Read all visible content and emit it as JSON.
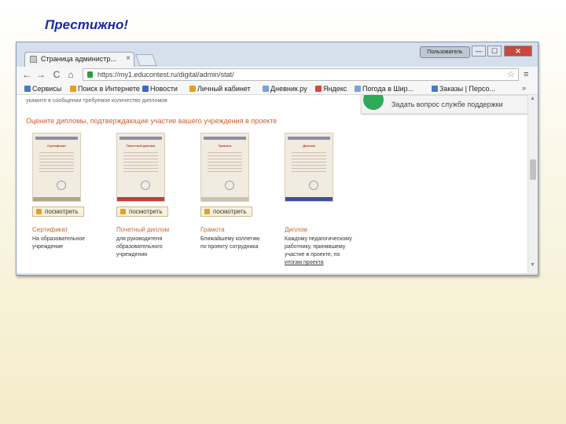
{
  "slide": {
    "title": "Престижно!"
  },
  "window": {
    "tab_title": "Страница администр...",
    "tab_close": "×",
    "profile_label": "Пользователь",
    "minimize": "—",
    "maximize": "☐",
    "close": "✕"
  },
  "toolbar": {
    "back": "←",
    "forward": "→",
    "reload": "C",
    "home": "⌂",
    "url": "https://my1.educontest.ru/digital/admin/stat/",
    "star": "☆",
    "menu": "≡"
  },
  "bookmarks": {
    "items": [
      {
        "label": "Сервисы",
        "color": "#4a78c8"
      },
      {
        "label": "Поиск в Интернете",
        "color": "#e2a125"
      },
      {
        "label": "Новости",
        "color": "#3d6bc1"
      },
      {
        "label": "Личный кабинет",
        "color": "#e2a125"
      },
      {
        "label": "Дневник.ру",
        "color": "#7aa3d8"
      },
      {
        "label": "Яндекс",
        "color": "#d9473d"
      },
      {
        "label": "Погода в Шир...",
        "color": "#7aa3d8"
      },
      {
        "label": "Заказы | Персо...",
        "color": "#4a78c8"
      }
    ],
    "more": "»"
  },
  "page": {
    "notice": "укажите в сообщении требуемое количество дипломов",
    "section_heading": "Оцените дипломы, подтверждающие участие вашего учреждения в проекте",
    "support_text": "Задать вопрос службе поддержки",
    "download_label": "посмотреть",
    "awards": [
      {
        "name": "Сертификат",
        "desc": [
          "На образовательное",
          "учреждение"
        ],
        "color": "#b2a68a"
      },
      {
        "name": "Почетный диплом",
        "desc": [
          "для руководителя",
          "образовательного",
          "учреждения"
        ],
        "color": "#b9423a"
      },
      {
        "name": "Грамота",
        "desc": [
          "Ближайшему коллегию",
          "по проекту сотрудника"
        ],
        "color": "#c9c2b0"
      },
      {
        "name": "Диплом",
        "desc": [
          "Каждому педагогическому",
          "работнику, принявшему",
          "участие в проекте, по",
          "итогам проекта"
        ],
        "color": "#3c4f9a"
      }
    ]
  }
}
